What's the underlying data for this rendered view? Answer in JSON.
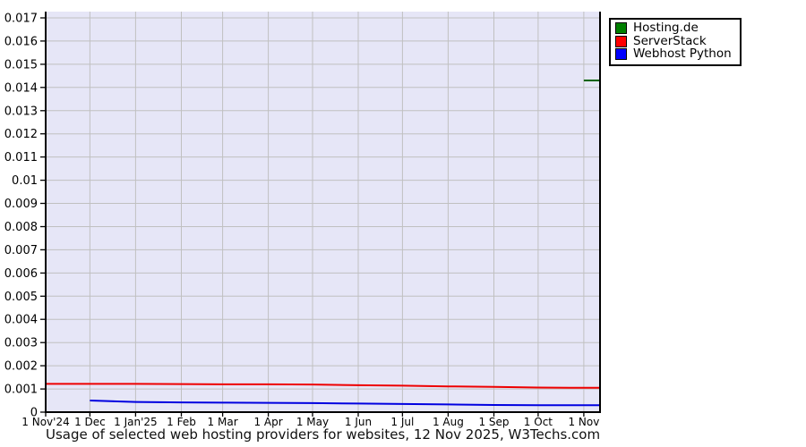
{
  "chart_data": {
    "type": "line",
    "title": "Usage of selected web hosting providers for websites, 12 Nov 2025, W3Techs.com",
    "x_unit": "days since 1 Nov 2024",
    "x_total_days": 376,
    "x_ticks": [
      {
        "day": 0,
        "label": "1 Nov'24"
      },
      {
        "day": 30,
        "label": "1 Dec"
      },
      {
        "day": 61,
        "label": "1 Jan'25"
      },
      {
        "day": 92,
        "label": "1 Feb"
      },
      {
        "day": 120,
        "label": "1 Mar"
      },
      {
        "day": 151,
        "label": "1 Apr"
      },
      {
        "day": 181,
        "label": "1 May"
      },
      {
        "day": 212,
        "label": "1 Jun"
      },
      {
        "day": 242,
        "label": "1 Jul"
      },
      {
        "day": 273,
        "label": "1 Aug"
      },
      {
        "day": 304,
        "label": "1 Sep"
      },
      {
        "day": 334,
        "label": "1 Oct"
      },
      {
        "day": 365,
        "label": "1 Nov"
      }
    ],
    "ylim": [
      0,
      0.017
    ],
    "grid": true,
    "legend_position": "top-right",
    "y_ticks": [
      {
        "value": 0,
        "label": "0"
      },
      {
        "value": 0.001,
        "label": "0.001"
      },
      {
        "value": 0.002,
        "label": "0.002"
      },
      {
        "value": 0.003,
        "label": "0.003"
      },
      {
        "value": 0.004,
        "label": "0.004"
      },
      {
        "value": 0.005,
        "label": "0.005"
      },
      {
        "value": 0.006,
        "label": "0.006"
      },
      {
        "value": 0.007,
        "label": "0.007"
      },
      {
        "value": 0.008,
        "label": "0.008"
      },
      {
        "value": 0.009,
        "label": "0.009"
      },
      {
        "value": 0.01,
        "label": "0.01"
      },
      {
        "value": 0.011,
        "label": "0.011"
      },
      {
        "value": 0.012,
        "label": "0.012"
      },
      {
        "value": 0.013,
        "label": "0.013"
      },
      {
        "value": 0.014,
        "label": "0.014"
      },
      {
        "value": 0.015,
        "label": "0.015"
      },
      {
        "value": 0.016,
        "label": "0.016"
      },
      {
        "value": 0.017,
        "label": "0.017"
      }
    ],
    "series": [
      {
        "name": "Hosting.de",
        "line_color": "#006400",
        "swatch_color": "#008000",
        "points": [
          [
            365,
            0.0143
          ],
          [
            376,
            0.0143
          ]
        ]
      },
      {
        "name": "ServerStack",
        "line_color": "#ee0000",
        "swatch_color": "#ff0000",
        "points": [
          [
            0,
            0.00122
          ],
          [
            30,
            0.00122
          ],
          [
            61,
            0.00122
          ],
          [
            92,
            0.00121
          ],
          [
            120,
            0.0012
          ],
          [
            151,
            0.0012
          ],
          [
            181,
            0.00119
          ],
          [
            212,
            0.00116
          ],
          [
            242,
            0.00114
          ],
          [
            273,
            0.00111
          ],
          [
            304,
            0.00109
          ],
          [
            334,
            0.00106
          ],
          [
            365,
            0.00105
          ],
          [
            376,
            0.00105
          ]
        ]
      },
      {
        "name": "Webhost Python",
        "line_color": "#0000e0",
        "swatch_color": "#0000ff",
        "points": [
          [
            30,
            0.0005
          ],
          [
            61,
            0.00044
          ],
          [
            92,
            0.00042
          ],
          [
            120,
            0.00041
          ],
          [
            151,
            0.0004
          ],
          [
            181,
            0.00039
          ],
          [
            212,
            0.00037
          ],
          [
            242,
            0.00035
          ],
          [
            273,
            0.00033
          ],
          [
            304,
            0.00031
          ],
          [
            334,
            0.0003
          ],
          [
            365,
            0.0003
          ],
          [
            376,
            0.0003
          ]
        ]
      }
    ]
  },
  "colors": {
    "plot_bg": "#e6e6f7",
    "grid": "#c0c0c0",
    "axis": "#000000",
    "text": "#000000"
  }
}
